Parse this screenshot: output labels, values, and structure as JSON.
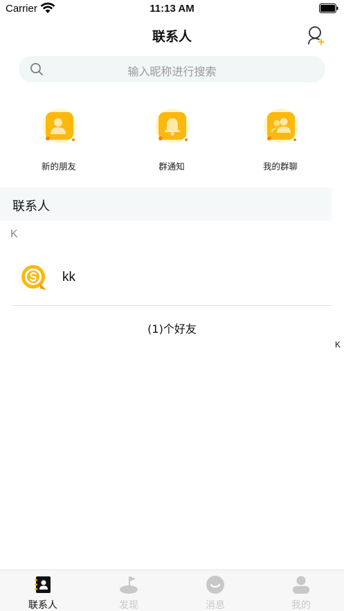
{
  "status_bar": {
    "carrier": "Carrier",
    "time": "11:13 AM"
  },
  "nav": {
    "title": "联系人",
    "add_friend_icon": "add-user-icon"
  },
  "search": {
    "placeholder": "输入昵称进行搜索"
  },
  "quick_actions": [
    {
      "label": "新的朋友",
      "icon": "new-friend-icon"
    },
    {
      "label": "群通知",
      "icon": "bell-icon"
    },
    {
      "label": "我的群聊",
      "icon": "group-chat-icon"
    }
  ],
  "section": {
    "title": "联系人"
  },
  "groups": [
    {
      "letter": "K",
      "contacts": [
        {
          "name": "kk"
        }
      ]
    }
  ],
  "friend_count": "(1)个好友",
  "index_bar": [
    "K"
  ],
  "tabs": [
    {
      "label": "联系人",
      "icon": "contacts-icon",
      "active": true
    },
    {
      "label": "发现",
      "icon": "discover-icon",
      "active": false
    },
    {
      "label": "消息",
      "icon": "message-icon",
      "active": false
    },
    {
      "label": "我的",
      "icon": "profile-icon",
      "active": false
    }
  ],
  "colors": {
    "accent": "#fbb80e",
    "accent_dark": "#f29a00",
    "search_bg": "#f1f6f6",
    "section_bg": "#f4f8f8",
    "inactive_tab": "#c8c8c8"
  }
}
